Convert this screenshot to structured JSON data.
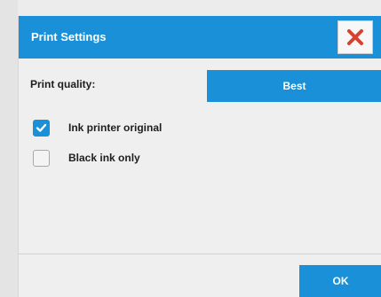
{
  "dialog": {
    "title": "Print Settings",
    "close_icon": "close-x-icon"
  },
  "print_quality": {
    "label": "Print quality:",
    "selected_value": "Best"
  },
  "options": [
    {
      "label": "Ink printer original",
      "checked": true,
      "icon": "checkmark-icon"
    },
    {
      "label": "Black ink only",
      "checked": false
    }
  ],
  "footer": {
    "ok_label": "OK"
  },
  "colors": {
    "accent": "#1a90d8",
    "close_x": "#d9402f",
    "background": "#efefef"
  }
}
